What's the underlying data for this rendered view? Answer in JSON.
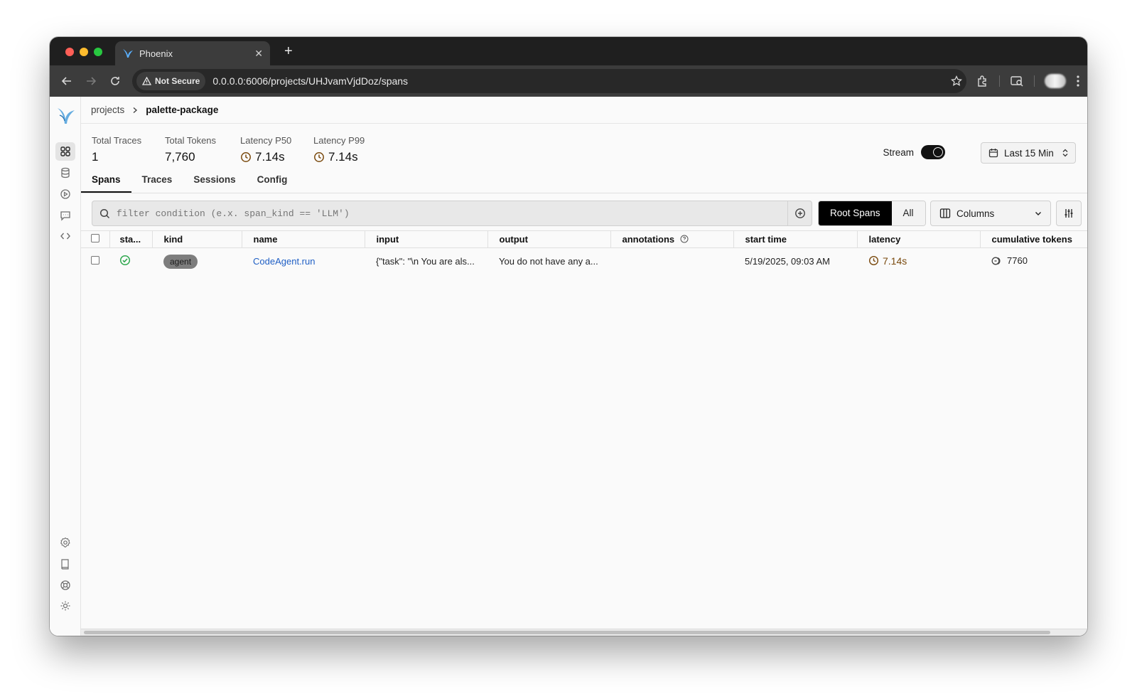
{
  "browser": {
    "tab_title": "Phoenix",
    "security_label": "Not Secure",
    "url": "0.0.0.0:6006/projects/UHJvamVjdDoz/spans"
  },
  "breadcrumb": {
    "root": "projects",
    "current": "palette-package"
  },
  "stats": [
    {
      "label": "Total Traces",
      "value": "1"
    },
    {
      "label": "Total Tokens",
      "value": "7,760"
    },
    {
      "label": "Latency P50",
      "value": "7.14s"
    },
    {
      "label": "Latency P99",
      "value": "7.14s"
    }
  ],
  "stream": {
    "label": "Stream",
    "enabled": true
  },
  "time_range": {
    "label": "Last 15 Min"
  },
  "tabs": [
    "Spans",
    "Traces",
    "Sessions",
    "Config"
  ],
  "active_tab": "Spans",
  "filter": {
    "placeholder": "filter condition (e.x. span_kind == 'LLM')"
  },
  "span_toggle": {
    "root": "Root Spans",
    "all": "All",
    "selected": "Root Spans"
  },
  "columns_button": {
    "label": "Columns"
  },
  "table": {
    "headers": [
      "sta...",
      "kind",
      "name",
      "input",
      "output",
      "annotations",
      "start time",
      "latency",
      "cumulative tokens"
    ],
    "rows": [
      {
        "status": "ok",
        "kind": "agent",
        "name": "CodeAgent.run",
        "input": "{\"task\": \"\\n You are als...",
        "output": "You do not have any a...",
        "annotations": "",
        "start_time": "5/19/2025, 09:03 AM",
        "latency": "7.14s",
        "cumulative_tokens": "7760"
      }
    ]
  },
  "colors": {
    "accent_link": "#1f5fc5",
    "latency": "#7a4a0e",
    "status_ok": "#2fa84f",
    "logo": "#4a9eda"
  }
}
